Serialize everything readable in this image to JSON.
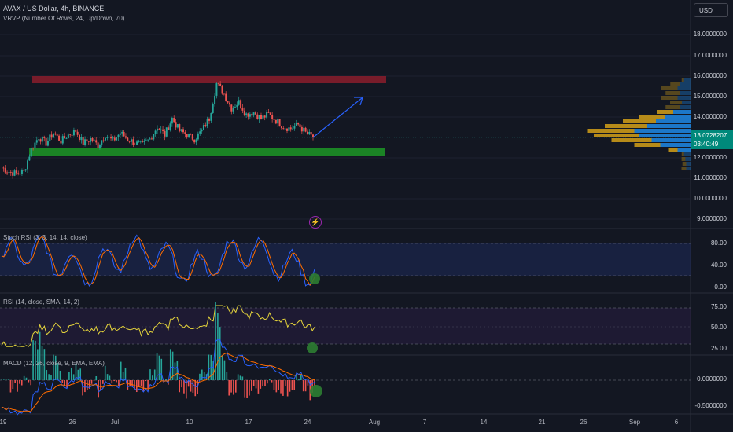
{
  "header": {
    "symbol_line": "AVAX / US Dollar, 4h, BINANCE",
    "indicator_line": "VRVP (Number Of Rows, 24, Up/Down, 70)"
  },
  "currency_button": "USD",
  "current_price": {
    "value": "13.0728207",
    "countdown": "03:40:49"
  },
  "price_axis": [
    "18.0000000",
    "17.0000000",
    "16.0000000",
    "15.0000000",
    "14.0000000",
    "12.0000000",
    "11.0000000",
    "10.0000000",
    "9.0000000"
  ],
  "time_axis": [
    "19",
    "26",
    "Jul",
    "10",
    "17",
    "24",
    "Aug",
    "7",
    "14",
    "21",
    "26",
    "Sep",
    "6"
  ],
  "panes": {
    "stoch_rsi": {
      "title": "Stoch RSI (3, 3, 14, 14, close)",
      "ticks": [
        "80.00",
        "40.00",
        "0.00"
      ]
    },
    "rsi": {
      "title": "RSI (14, close, SMA, 14, 2)",
      "ticks": [
        "75.00",
        "50.00",
        "25.00"
      ]
    },
    "macd": {
      "title": "MACD (12, 26, close, 9, EMA, EMA)",
      "ticks": [
        "0.0000000",
        "-0.5000000"
      ]
    }
  },
  "colors": {
    "background": "#131722",
    "resistance_zone": "#8b1d2c",
    "support_zone": "#1b8a26",
    "candle_up": "#26a69a",
    "candle_down": "#ef5350",
    "projection_arrow": "#2962ff",
    "rsi_line": "#e5d43b",
    "stoch_k": "#2962ff",
    "stoch_d": "#ff6d00",
    "volume_up": "#1e88e5",
    "volume_down": "#d4a017",
    "marker": "#2e7d32"
  },
  "icons": {
    "alert": "lightning-icon"
  },
  "chart_data": {
    "type": "candlestick",
    "symbol": "AVAX / US Dollar",
    "interval": "4h",
    "exchange": "BINANCE",
    "ylim": [
      8.5,
      18.5
    ],
    "approx_closes": [
      11.6,
      11.4,
      11.3,
      11.4,
      12.5,
      13.1,
      12.8,
      13.3,
      12.9,
      13.2,
      13.4,
      12.8,
      13.0,
      12.7,
      13.2,
      12.9,
      13.3,
      13.0,
      12.8,
      12.7,
      13.0,
      13.6,
      13.2,
      14.0,
      13.4,
      13.2,
      13.0,
      13.4,
      14.0,
      15.7,
      15.2,
      14.5,
      14.8,
      14.2,
      14.3,
      14.0,
      14.2,
      13.9,
      13.6,
      13.5,
      13.7,
      13.3,
      13.1
    ],
    "zones": [
      {
        "name": "resistance",
        "from": 15.7,
        "to": 16.0
      },
      {
        "name": "support",
        "from": 12.1,
        "to": 12.4
      }
    ]
  }
}
